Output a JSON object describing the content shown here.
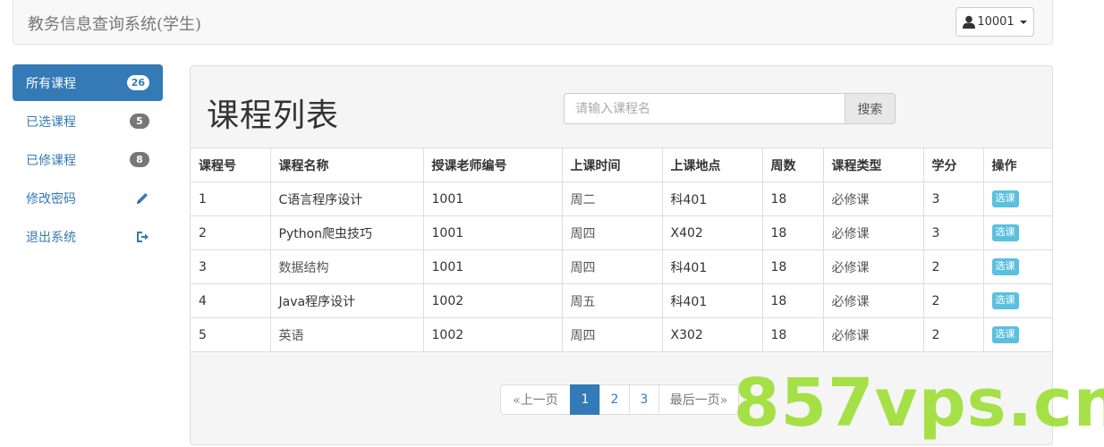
{
  "app": {
    "title": "教务信息查询系统(学生)"
  },
  "user": {
    "id": "10001",
    "icon": "user-icon"
  },
  "sidebar": {
    "items": [
      {
        "label": "所有课程",
        "badge": "26",
        "active": true
      },
      {
        "label": "已选课程",
        "badge": "5"
      },
      {
        "label": "已修课程",
        "badge": "8"
      },
      {
        "label": "修改密码",
        "icon": "pencil-icon"
      },
      {
        "label": "退出系统",
        "icon": "logout-icon"
      }
    ]
  },
  "main": {
    "title": "课程列表",
    "search": {
      "placeholder": "请输入课程名",
      "button_label": "搜索"
    },
    "table": {
      "headers": [
        "课程号",
        "课程名称",
        "授课老师编号",
        "上课时间",
        "上课地点",
        "周数",
        "课程类型",
        "学分",
        "操作"
      ],
      "rows": [
        {
          "id": "1",
          "name": "C语言程序设计",
          "teacher": "1001",
          "time": "周二",
          "place": "科401",
          "weeks": "18",
          "type": "必修课",
          "credit": "3",
          "action": "选课"
        },
        {
          "id": "2",
          "name": "Python爬虫技巧",
          "teacher": "1001",
          "time": "周四",
          "place": "X402",
          "weeks": "18",
          "type": "必修课",
          "credit": "3",
          "action": "选课"
        },
        {
          "id": "3",
          "name": "数据结构",
          "teacher": "1001",
          "time": "周四",
          "place": "科401",
          "weeks": "18",
          "type": "必修课",
          "credit": "2",
          "action": "选课"
        },
        {
          "id": "4",
          "name": "Java程序设计",
          "teacher": "1002",
          "time": "周五",
          "place": "科401",
          "weeks": "18",
          "type": "必修课",
          "credit": "2",
          "action": "选课"
        },
        {
          "id": "5",
          "name": "英语",
          "teacher": "1002",
          "time": "周四",
          "place": "X302",
          "weeks": "18",
          "type": "必修课",
          "credit": "2",
          "action": "选课"
        }
      ]
    },
    "pagination": {
      "prev_label": "«上一页",
      "pages": [
        "1",
        "2",
        "3"
      ],
      "current": "1",
      "last_label": "最后一页»"
    }
  },
  "watermark": "857vps.cn",
  "colors": {
    "primary": "#337ab7",
    "info": "#5bc0de",
    "badge": "#777777",
    "watermark": "#96dc28"
  }
}
